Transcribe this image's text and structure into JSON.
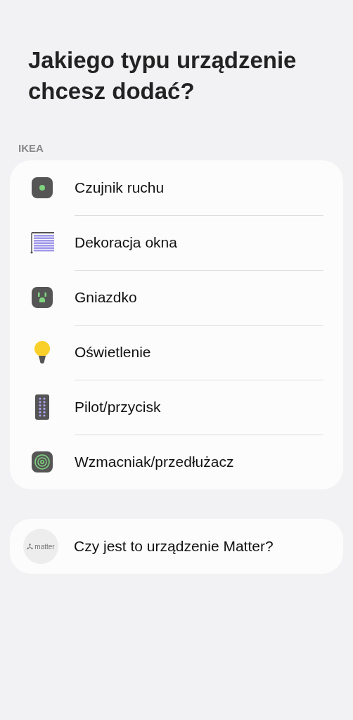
{
  "title": "Jakiego typu urządzenie chcesz dodać?",
  "section": {
    "label": "IKEA",
    "items": [
      {
        "kind": "sensor",
        "label": "Czujnik ruchu"
      },
      {
        "kind": "blind",
        "label": "Dekoracja okna"
      },
      {
        "kind": "outlet",
        "label": "Gniazdko"
      },
      {
        "kind": "bulb",
        "label": "Oświetlenie"
      },
      {
        "kind": "remote",
        "label": "Pilot/przycisk"
      },
      {
        "kind": "repeater",
        "label": "Wzmacniak/przedłużacz"
      }
    ]
  },
  "matter": {
    "logo_text": "matter",
    "label": "Czy jest to urządzenie Matter?"
  }
}
